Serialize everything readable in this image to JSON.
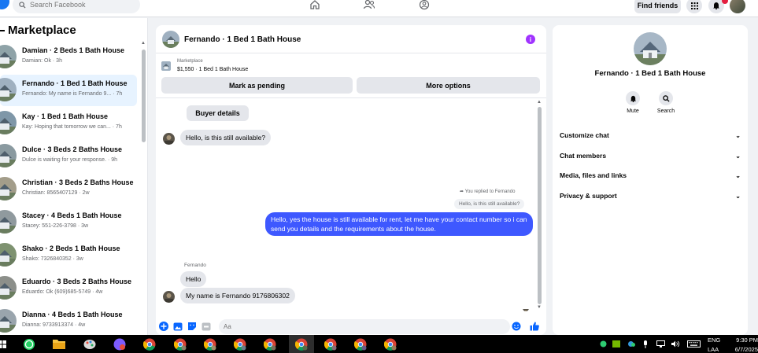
{
  "topbar": {
    "search_placeholder": "Search Facebook",
    "find_friends_label": "Find friends",
    "icons": [
      "home-icon",
      "friends-icon",
      "groups-icon",
      "menu-grid-icon",
      "notifications-icon"
    ]
  },
  "left": {
    "title": "Marketplace",
    "conversations": [
      {
        "name": "Damian · 2 Beds 1 Bath House",
        "snippet": "Damian: Ok · 3h",
        "active": false
      },
      {
        "name": "Fernando · 1 Bed 1 Bath House",
        "snippet": "Fernando: My name is Fernando 9... · 7h",
        "active": true
      },
      {
        "name": "Kay · 1 Bed 1 Bath House",
        "snippet": "Kay: Hoping that tomorrow we can... · 7h",
        "active": false
      },
      {
        "name": "Dulce · 3 Beds 2 Baths House",
        "snippet": "Dulce is waiting for your response. · 9h",
        "active": false
      },
      {
        "name": "Christian · 3 Beds 2 Baths House",
        "snippet": "Christian: 8565407129 · 2w",
        "active": false
      },
      {
        "name": "Stacey · 4 Beds 1 Bath House",
        "snippet": "Stacey: 551-226-3798 · 3w",
        "active": false
      },
      {
        "name": "Shako · 2 Beds 1 Bath House",
        "snippet": "Shako: 7326840352 · 3w",
        "active": false
      },
      {
        "name": "Eduardo · 3 Beds 2 Baths House",
        "snippet": "Eduardo: Ok (609)685-5749 · 4w",
        "active": false
      },
      {
        "name": "Dianna · 4 Beds 1 Bath House",
        "snippet": "Dianna: 9733913374 · 4w",
        "active": false
      }
    ]
  },
  "chat": {
    "title": "Fernando · 1 Bed 1 Bath House",
    "marketplace_label": "Marketplace",
    "listing_price": "$1,550 · 1 Bed 1 Bath House",
    "mark_pending_label": "Mark as pending",
    "more_options_label": "More options",
    "buyer_details_label": "Buyer details",
    "messages": {
      "m1": "Hello, is this still available?",
      "replied_note": "You replied to Fernando",
      "quoted": "Hello, is this still available?",
      "reply": "Hello, yes the house is still available for rent, let me have your contact number so i can send you details and the requirements about the house.",
      "sender": "Fernando",
      "m2": "Hello",
      "m3": "My name is Fernando 9176806302"
    },
    "composer_placeholder": "Aa"
  },
  "right": {
    "title": "Fernando · 1 Bed 1 Bath House",
    "mute_label": "Mute",
    "search_label": "Search",
    "sections": [
      "Customize chat",
      "Chat members",
      "Media, files and links",
      "Privacy & support"
    ]
  },
  "taskbar": {
    "lang_top": "ENG",
    "lang_bottom": "LAA",
    "time": "9:30 PM",
    "date": "6/7/2025"
  },
  "colors": {
    "accent": "#1877f2",
    "outgoing_bubble": "#3e58ff",
    "incoming_bubble": "#e4e6eb",
    "active_row": "#e7f3ff",
    "info_icon": "#a033ff"
  }
}
